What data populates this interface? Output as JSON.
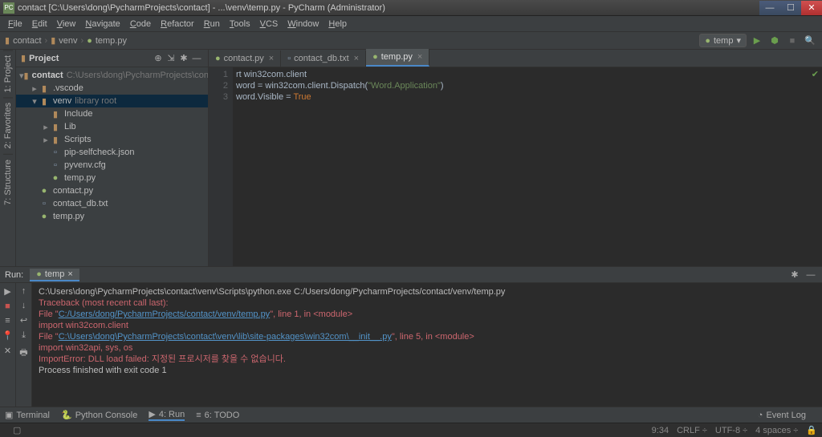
{
  "window": {
    "title": "contact [C:\\Users\\dong\\PycharmProjects\\contact] - ...\\venv\\temp.py - PyCharm (Administrator)",
    "app_badge": "PC"
  },
  "menu": [
    "File",
    "Edit",
    "View",
    "Navigate",
    "Code",
    "Refactor",
    "Run",
    "Tools",
    "VCS",
    "Window",
    "Help"
  ],
  "breadcrumbs": [
    "contact",
    "venv",
    "temp.py"
  ],
  "run_config": {
    "name": "temp"
  },
  "project": {
    "title": "Project",
    "root": {
      "label": "contact",
      "path": "C:\\Users\\dong\\PycharmProjects\\contact"
    },
    "nodes": [
      {
        "depth": 1,
        "exp": "▸",
        "icon": "folder",
        "label": ".vscode"
      },
      {
        "depth": 1,
        "exp": "▾",
        "icon": "folder",
        "label": "venv",
        "hint": "library root",
        "sel": true
      },
      {
        "depth": 2,
        "exp": "",
        "icon": "folder",
        "label": "Include"
      },
      {
        "depth": 2,
        "exp": "▸",
        "icon": "folder",
        "label": "Lib"
      },
      {
        "depth": 2,
        "exp": "▸",
        "icon": "folder",
        "label": "Scripts"
      },
      {
        "depth": 2,
        "exp": "",
        "icon": "file",
        "label": "pip-selfcheck.json"
      },
      {
        "depth": 2,
        "exp": "",
        "icon": "file",
        "label": "pyvenv.cfg"
      },
      {
        "depth": 2,
        "exp": "",
        "icon": "py",
        "label": "temp.py"
      },
      {
        "depth": 1,
        "exp": "",
        "icon": "py",
        "label": "contact.py"
      },
      {
        "depth": 1,
        "exp": "",
        "icon": "file",
        "label": "contact_db.txt"
      },
      {
        "depth": 1,
        "exp": "",
        "icon": "py",
        "label": "temp.py"
      }
    ]
  },
  "sidebar_tabs": [
    "1: Project",
    "2: Favorites",
    "7: Structure"
  ],
  "editor_tabs": [
    {
      "label": "contact.py",
      "icon": "py",
      "active": false
    },
    {
      "label": "contact_db.txt",
      "icon": "file",
      "active": false
    },
    {
      "label": "temp.py",
      "icon": "py",
      "active": true
    }
  ],
  "editor": {
    "line_numbers": [
      "1",
      "2",
      "3"
    ],
    "line1_pre": "rt ",
    "line1_id": "win32com.client",
    "line2_a": "word = win32com.client.Dispatch(",
    "line2_str": "\"Word.Application\"",
    "line2_b": ")",
    "line3_a": "word.Visible = ",
    "line3_kw": "True"
  },
  "run": {
    "label": "Run:",
    "tab": "temp",
    "lines": {
      "cmd": "C:\\Users\\dong\\PycharmProjects\\contact\\venv\\Scripts\\python.exe C:/Users/dong/PycharmProjects/contact/venv/temp.py",
      "trace": "Traceback (most recent call last):",
      "file1a": "  File \"",
      "file1link": "C:/Users/dong/PycharmProjects/contact/venv/temp.py",
      "file1b": "\", line 1, in <module>",
      "imp1": "    import win32com.client",
      "file2a": "  File \"",
      "file2link": "C:\\Users\\dong\\PycharmProjects\\contact\\venv\\lib\\site-packages\\win32com\\__init__.py",
      "file2b": "\", line 5, in <module>",
      "imp2": "    import win32api, sys, os",
      "err": "ImportError: DLL load failed: 지정된 프로시저를 찾을 수 없습니다.",
      "blank": "",
      "exit": "Process finished with exit code 1"
    }
  },
  "bottom_tools": [
    {
      "icon": "▣",
      "label": "Terminal"
    },
    {
      "icon": "🐍",
      "label": "Python Console"
    },
    {
      "icon": "▶",
      "label": "4: Run",
      "active": true
    },
    {
      "icon": "≡",
      "label": "6: TODO"
    }
  ],
  "event_log": "Event Log",
  "status": {
    "pos": "9:34",
    "eol": "CRLF ÷",
    "enc": "UTF-8 ÷",
    "indent": "4 spaces ÷"
  }
}
